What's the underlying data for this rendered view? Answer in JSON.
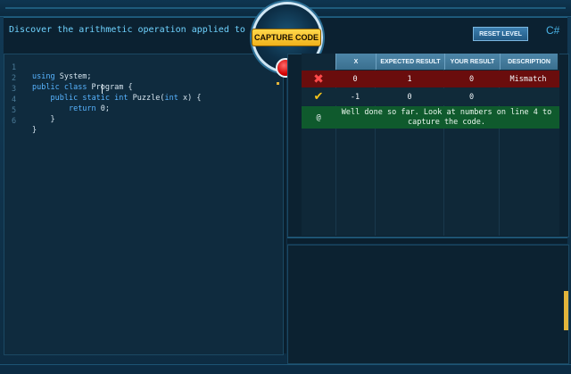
{
  "header": {
    "instruction": "Discover the arithmetic operation applied to 'x'.",
    "reset_label": "RESET LEVEL",
    "language": "C#"
  },
  "capture": {
    "label": "CAPTURE CODE"
  },
  "editor": {
    "lines": [
      {
        "n": "1",
        "text": "using System;"
      },
      {
        "n": "2",
        "text": "public class Program {"
      },
      {
        "n": "3",
        "text": "    public static int Puzzle(int x) {"
      },
      {
        "n": "4",
        "text": "        return 0;"
      },
      {
        "n": "5",
        "text": "    }"
      },
      {
        "n": "6",
        "text": "}"
      }
    ]
  },
  "results": {
    "headers": [
      "X",
      "EXPECTED RESULT",
      "YOUR RESULT",
      "DESCRIPTION"
    ],
    "rows": [
      {
        "status": "error",
        "x": "0",
        "expected": "1",
        "yours": "0",
        "description": "Mismatch"
      },
      {
        "status": "ok",
        "x": "-1",
        "expected": "0",
        "yours": "0",
        "description": ""
      }
    ],
    "hint": {
      "symbol": "@",
      "text": "Well done so far. Look at numbers on line 4 to capture the code."
    }
  },
  "colors": {
    "accent": "#6fd3ff",
    "error_row": "#6a0d0d",
    "hint_row": "#0f5a2d",
    "capture": "#f0b21c"
  }
}
